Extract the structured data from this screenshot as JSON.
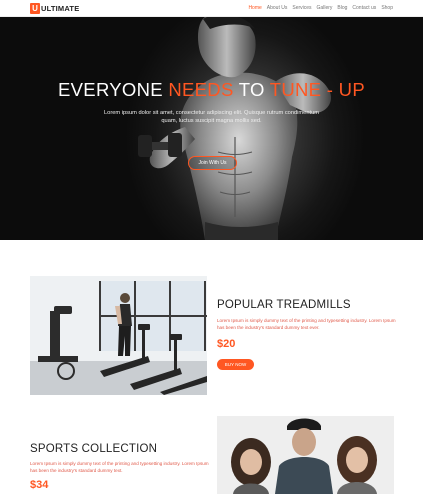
{
  "nav": {
    "logo_letter": "U",
    "logo_text": "ULTIMATE",
    "items": [
      {
        "label": "Home",
        "active": true
      },
      {
        "label": "About Us",
        "active": false
      },
      {
        "label": "Services",
        "active": false
      },
      {
        "label": "Gallery",
        "active": false
      },
      {
        "label": "Blog",
        "active": false
      },
      {
        "label": "Contact us",
        "active": false
      },
      {
        "label": "Shop",
        "active": false
      }
    ]
  },
  "hero": {
    "title_part1": "EVERYONE ",
    "title_highlight": "NEEDS",
    "title_part2": " TO ",
    "title_highlight2": "TUNE - UP",
    "subtitle": "Lorem ipsum dolor sit amet, consectetur adipiscing elit. Quisque rutrum condimentum quam, luctus suscipit magna mollis sed.",
    "button": "Join With Us"
  },
  "section1": {
    "title": "POPULAR TREADMILLS",
    "desc": "Lorem Ipsum is simply dummy text of the printing and typesetting industry. Lorem Ipsum has been the industry's standard dummy text ever.",
    "price": "$20",
    "button": "BUY NOW"
  },
  "section2": {
    "title": "SPORTS COLLECTION",
    "desc": "Lorem Ipsum is simply dummy text of the printing and typesetting industry. Lorem Ipsum has been the industry's standard dummy text.",
    "price": "$34"
  },
  "colors": {
    "accent": "#ff5722",
    "text_dark": "#222222",
    "desc_red": "#e05a4a"
  }
}
